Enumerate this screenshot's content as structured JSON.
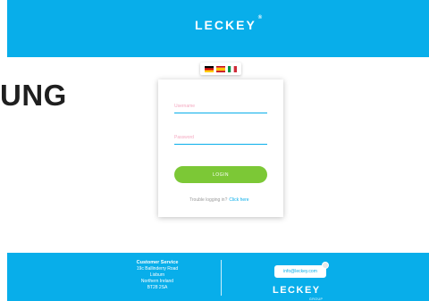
{
  "header": {
    "brand": "LECKEY",
    "registered": "®",
    "color": "#08aeea"
  },
  "headline": "UNG",
  "languages": [
    {
      "name": "german-flag-icon",
      "label": "German"
    },
    {
      "name": "spanish-flag-icon",
      "label": "Spanish"
    },
    {
      "name": "italian-flag-icon",
      "label": "Italian"
    }
  ],
  "login": {
    "username_placeholder": "Username",
    "password_placeholder": "Password",
    "button_label": "LOGIN",
    "trouble_text": "Trouble logging in?",
    "click_here": "Click here",
    "button_color": "#7cc836"
  },
  "footer": {
    "cs_title": "Customer Service",
    "address_lines": [
      "19c Ballinderry Road",
      "Lisburn",
      "Northern Ireland",
      "BT28 2SA"
    ],
    "email": "info@leckey.com",
    "brand": "LECKEY",
    "group": "GROUP"
  }
}
